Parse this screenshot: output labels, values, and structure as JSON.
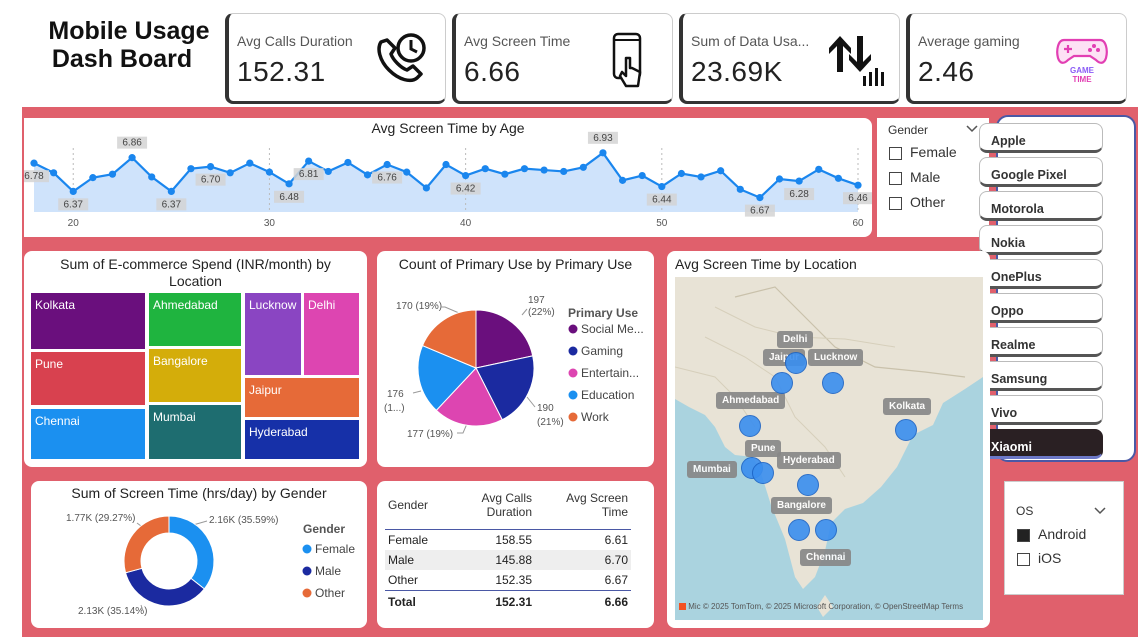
{
  "dashboard": {
    "title_line1": "Mobile Usage",
    "title_line2": "Dash Board"
  },
  "kpis": [
    {
      "label": "Avg Calls Duration",
      "value": "152.31",
      "icon": "phone-clock-icon"
    },
    {
      "label": "Avg Screen Time",
      "value": "6.66",
      "icon": "touch-phone-icon"
    },
    {
      "label": "Sum of Data Usa...",
      "value": "23.69K",
      "icon": "data-transfer-icon"
    },
    {
      "label": "Average gaming",
      "value": "2.46",
      "icon": "game-time-icon"
    }
  ],
  "game_icon_text": [
    "GAME",
    "TIME"
  ],
  "age_chart": {
    "title": "Avg Screen Time by Age",
    "point_labels": [
      "6.78",
      "6.37",
      "6.86",
      "6.37",
      "6.70",
      "6.48",
      "6.81",
      "6.76",
      "6.42",
      "6.93",
      "6.44",
      "6.67",
      "6.28",
      "6.46"
    ]
  },
  "gender_filter": {
    "title": "Gender",
    "options": [
      "Female",
      "Male",
      "Other"
    ]
  },
  "brands": [
    "Apple",
    "Google Pixel",
    "Motorola",
    "Nokia",
    "OnePlus",
    "Oppo",
    "Realme",
    "Samsung",
    "Vivo",
    "Xiaomi"
  ],
  "selected_brand": "Xiaomi",
  "os_filter": {
    "title": "OS",
    "options": [
      {
        "label": "Android",
        "checked": true
      },
      {
        "label": "iOS",
        "checked": false
      }
    ]
  },
  "treemap": {
    "title_line1": "Sum of E-commerce Spend (INR/month) by",
    "title_line2": "Location",
    "cells": [
      {
        "label": "Kolkata",
        "color": "#6a0f7d"
      },
      {
        "label": "Ahmedabad",
        "color": "#1fb43f"
      },
      {
        "label": "Lucknow",
        "color": "#8a45c2"
      },
      {
        "label": "Delhi",
        "color": "#dd45b1"
      },
      {
        "label": "Pune",
        "color": "#d8414f"
      },
      {
        "label": "Bangalore",
        "color": "#d4ad0a"
      },
      {
        "label": "Jaipur",
        "color": "#e66a38"
      },
      {
        "label": "Chennai",
        "color": "#1b90f0"
      },
      {
        "label": "Mumbai",
        "color": "#1e6d70"
      },
      {
        "label": "Hyderabad",
        "color": "#1630a8"
      }
    ]
  },
  "primary_use_chart": {
    "title": "Count of Primary Use by Primary Use",
    "legend_title": "Primary Use",
    "slice_labels": [
      "197",
      "(22%)",
      "190",
      "(21%)",
      "177 (19%)",
      "176",
      "(1...)",
      "170 (19%)"
    ]
  },
  "chart_data": [
    {
      "type": "line",
      "title": "Avg Screen Time by Age",
      "x": [
        18,
        19,
        20,
        21,
        22,
        23,
        24,
        25,
        26,
        27,
        28,
        29,
        30,
        31,
        32,
        33,
        34,
        35,
        36,
        37,
        38,
        39,
        40,
        41,
        42,
        43,
        44,
        45,
        46,
        47,
        48,
        49,
        50,
        51,
        52,
        53,
        54,
        55,
        56,
        57,
        58,
        59,
        60
      ],
      "y": [
        6.78,
        6.64,
        6.37,
        6.57,
        6.62,
        6.86,
        6.58,
        6.37,
        6.7,
        6.73,
        6.64,
        6.78,
        6.65,
        6.48,
        6.81,
        6.66,
        6.79,
        6.61,
        6.76,
        6.65,
        6.42,
        6.76,
        6.6,
        6.7,
        6.62,
        6.7,
        6.68,
        6.66,
        6.72,
        6.93,
        6.53,
        6.6,
        6.44,
        6.63,
        6.58,
        6.67,
        6.4,
        6.28,
        6.55,
        6.52,
        6.69,
        6.56,
        6.46
      ],
      "xticks": [
        20,
        30,
        40,
        50,
        60
      ]
    },
    {
      "type": "pie",
      "title": "Count of Primary Use by Primary Use",
      "categories": [
        "Social Me...",
        "Gaming",
        "Entertain...",
        "Education",
        "Work"
      ],
      "values": [
        197,
        190,
        177,
        176,
        170
      ],
      "colors": [
        "#6a0f7d",
        "#1b2aa0",
        "#dd45b1",
        "#1b90f0",
        "#e66a38"
      ]
    },
    {
      "type": "pie",
      "title": "Sum of Screen Time (hrs/day) by Gender",
      "categories": [
        "Female",
        "Male",
        "Other"
      ],
      "values": [
        2160,
        2130,
        1770
      ],
      "value_labels": [
        "2.16K (35.59%)",
        "2.13K (35.14%)",
        "1.77K (29.27%)"
      ],
      "colors": [
        "#1b90f0",
        "#1b2aa0",
        "#e66a38"
      ]
    }
  ],
  "gender_donut": {
    "title": "Sum of Screen Time (hrs/day) by Gender",
    "legend_title": "Gender"
  },
  "gender_table": {
    "headers": [
      "Gender",
      "Avg Calls Duration",
      "Avg Screen Time"
    ],
    "rows": [
      [
        "Female",
        "158.55",
        "6.61"
      ],
      [
        "Male",
        "145.88",
        "6.70"
      ],
      [
        "Other",
        "152.35",
        "6.67"
      ]
    ],
    "total": [
      "Total",
      "152.31",
      "6.66"
    ]
  },
  "map": {
    "title": "Avg Screen Time by Location",
    "cities": [
      "Delhi",
      "Jaipur",
      "Lucknow",
      "Ahmedabad",
      "Kolkata",
      "Pune",
      "Hyderabad",
      "Mumbai",
      "Bangalore",
      "Chennai"
    ],
    "attribution": "© 2025 TomTom, © 2025 Microsoft Corporation, © OpenStreetMap  Terms",
    "logo": "Mic"
  }
}
